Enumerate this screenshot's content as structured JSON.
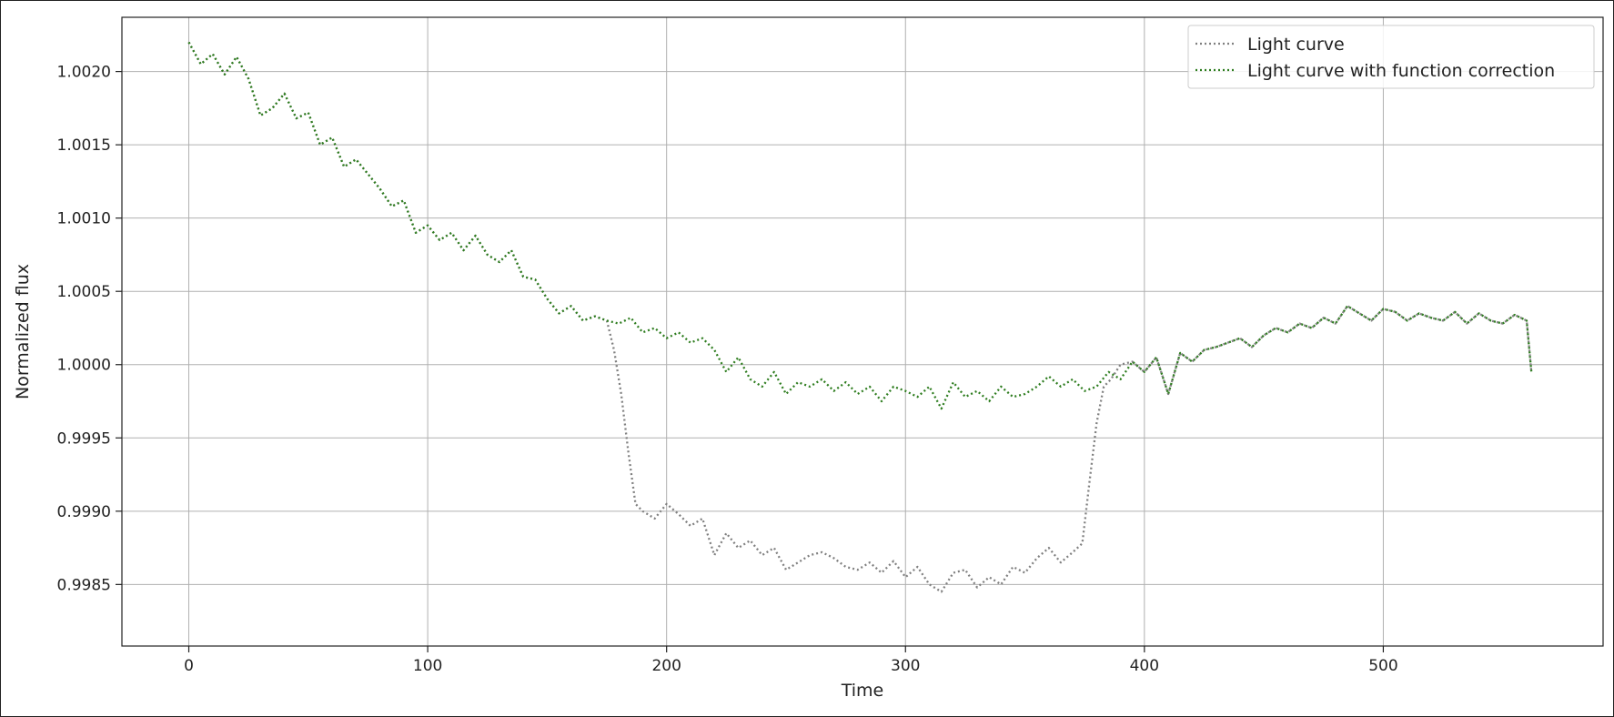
{
  "chart_data": {
    "type": "line",
    "title": "",
    "xlabel": "Time",
    "ylabel": "Normalized flux",
    "xlim": [
      -28,
      592
    ],
    "ylim": [
      0.99808,
      1.00237
    ],
    "grid": true,
    "legend_position": "top-right",
    "x_ticks": [
      0,
      100,
      200,
      300,
      400,
      500
    ],
    "x_tick_labels": [
      "0",
      "100",
      "200",
      "300",
      "400",
      "500"
    ],
    "y_ticks": [
      0.9985,
      0.999,
      0.9995,
      1.0,
      1.0005,
      1.001,
      1.0015,
      1.002
    ],
    "y_tick_labels": [
      "0.9985",
      "0.9990",
      "0.9995",
      "1.0000",
      "1.0005",
      "1.0010",
      "1.0015",
      "1.0020"
    ],
    "series": [
      {
        "name": "Light curve",
        "color": "#808080",
        "style": "dotted",
        "x": [
          0,
          5,
          10,
          15,
          20,
          25,
          30,
          35,
          40,
          45,
          50,
          55,
          60,
          65,
          70,
          75,
          80,
          85,
          90,
          95,
          100,
          105,
          110,
          115,
          120,
          125,
          130,
          135,
          140,
          145,
          150,
          155,
          160,
          165,
          170,
          175,
          178,
          181,
          184,
          187,
          190,
          195,
          200,
          205,
          210,
          215,
          220,
          225,
          230,
          235,
          240,
          245,
          250,
          255,
          260,
          265,
          270,
          275,
          280,
          285,
          290,
          295,
          300,
          305,
          310,
          315,
          320,
          325,
          330,
          335,
          340,
          345,
          350,
          355,
          360,
          365,
          370,
          374,
          377,
          380,
          383,
          386,
          390,
          395,
          400,
          405,
          410,
          415,
          420,
          425,
          430,
          435,
          440,
          445,
          450,
          455,
          460,
          465,
          470,
          475,
          480,
          485,
          490,
          495,
          500,
          505,
          510,
          515,
          520,
          525,
          530,
          535,
          540,
          545,
          550,
          555,
          560,
          562
        ],
        "y": [
          1.0022,
          1.00205,
          1.00212,
          1.00198,
          1.0021,
          1.00195,
          1.0017,
          1.00175,
          1.00185,
          1.00168,
          1.00172,
          1.0015,
          1.00155,
          1.00135,
          1.0014,
          1.0013,
          1.0012,
          1.00108,
          1.00112,
          1.0009,
          1.00095,
          1.00085,
          1.0009,
          1.00078,
          1.00088,
          1.00075,
          1.0007,
          1.00078,
          1.0006,
          1.00058,
          1.00045,
          1.00035,
          1.0004,
          1.0003,
          1.00033,
          1.0003,
          1.0001,
          0.9998,
          0.9994,
          0.99905,
          0.999,
          0.99895,
          0.99905,
          0.99898,
          0.9989,
          0.99895,
          0.9987,
          0.99885,
          0.99875,
          0.9988,
          0.9987,
          0.99875,
          0.9986,
          0.99865,
          0.9987,
          0.99872,
          0.99868,
          0.99862,
          0.9986,
          0.99865,
          0.99858,
          0.99866,
          0.99855,
          0.99862,
          0.9985,
          0.99845,
          0.99858,
          0.9986,
          0.99848,
          0.99855,
          0.9985,
          0.99862,
          0.99858,
          0.99868,
          0.99875,
          0.99865,
          0.99872,
          0.99878,
          0.9992,
          0.9996,
          0.99985,
          0.9999,
          1.0,
          1.00002,
          0.99995,
          1.00005,
          0.9998,
          1.00008,
          1.00002,
          1.0001,
          1.00012,
          1.00015,
          1.00018,
          1.00012,
          1.0002,
          1.00025,
          1.00022,
          1.00028,
          1.00025,
          1.00032,
          1.00028,
          1.0004,
          1.00035,
          1.0003,
          1.00038,
          1.00036,
          1.0003,
          1.00035,
          1.00032,
          1.0003,
          1.00036,
          1.00028,
          1.00035,
          1.0003,
          1.00028,
          1.00034,
          1.0003,
          0.99995
        ]
      },
      {
        "name": "Light curve with function correction",
        "color": "#2e7d1f",
        "style": "dotted",
        "x": [
          0,
          5,
          10,
          15,
          20,
          25,
          30,
          35,
          40,
          45,
          50,
          55,
          60,
          65,
          70,
          75,
          80,
          85,
          90,
          95,
          100,
          105,
          110,
          115,
          120,
          125,
          130,
          135,
          140,
          145,
          150,
          155,
          160,
          165,
          170,
          175,
          180,
          185,
          190,
          195,
          200,
          205,
          210,
          215,
          220,
          225,
          230,
          235,
          240,
          245,
          250,
          255,
          260,
          265,
          270,
          275,
          280,
          285,
          290,
          295,
          300,
          305,
          310,
          315,
          320,
          325,
          330,
          335,
          340,
          345,
          350,
          355,
          360,
          365,
          370,
          375,
          380,
          385,
          390,
          395,
          400,
          405,
          410,
          415,
          420,
          425,
          430,
          435,
          440,
          445,
          450,
          455,
          460,
          465,
          470,
          475,
          480,
          485,
          490,
          495,
          500,
          505,
          510,
          515,
          520,
          525,
          530,
          535,
          540,
          545,
          550,
          555,
          560,
          562
        ],
        "y": [
          1.0022,
          1.00205,
          1.00212,
          1.00198,
          1.0021,
          1.00195,
          1.0017,
          1.00175,
          1.00185,
          1.00168,
          1.00172,
          1.0015,
          1.00155,
          1.00135,
          1.0014,
          1.0013,
          1.0012,
          1.00108,
          1.00112,
          1.0009,
          1.00095,
          1.00085,
          1.0009,
          1.00078,
          1.00088,
          1.00075,
          1.0007,
          1.00078,
          1.0006,
          1.00058,
          1.00045,
          1.00035,
          1.0004,
          1.0003,
          1.00033,
          1.0003,
          1.00028,
          1.00032,
          1.00022,
          1.00025,
          1.00018,
          1.00022,
          1.00015,
          1.00018,
          1.0001,
          0.99995,
          1.00005,
          0.9999,
          0.99985,
          0.99995,
          0.9998,
          0.99988,
          0.99985,
          0.9999,
          0.99982,
          0.99988,
          0.9998,
          0.99985,
          0.99975,
          0.99985,
          0.99982,
          0.99978,
          0.99985,
          0.9997,
          0.99988,
          0.99978,
          0.99982,
          0.99975,
          0.99985,
          0.99978,
          0.9998,
          0.99985,
          0.99992,
          0.99985,
          0.9999,
          0.99982,
          0.99985,
          0.99995,
          0.9999,
          1.00002,
          0.99995,
          1.00005,
          0.9998,
          1.00008,
          1.00002,
          1.0001,
          1.00012,
          1.00015,
          1.00018,
          1.00012,
          1.0002,
          1.00025,
          1.00022,
          1.00028,
          1.00025,
          1.00032,
          1.00028,
          1.0004,
          1.00035,
          1.0003,
          1.00038,
          1.00036,
          1.0003,
          1.00035,
          1.00032,
          1.0003,
          1.00036,
          1.00028,
          1.00035,
          1.0003,
          1.00028,
          1.00034,
          1.0003,
          0.99995
        ]
      }
    ]
  }
}
